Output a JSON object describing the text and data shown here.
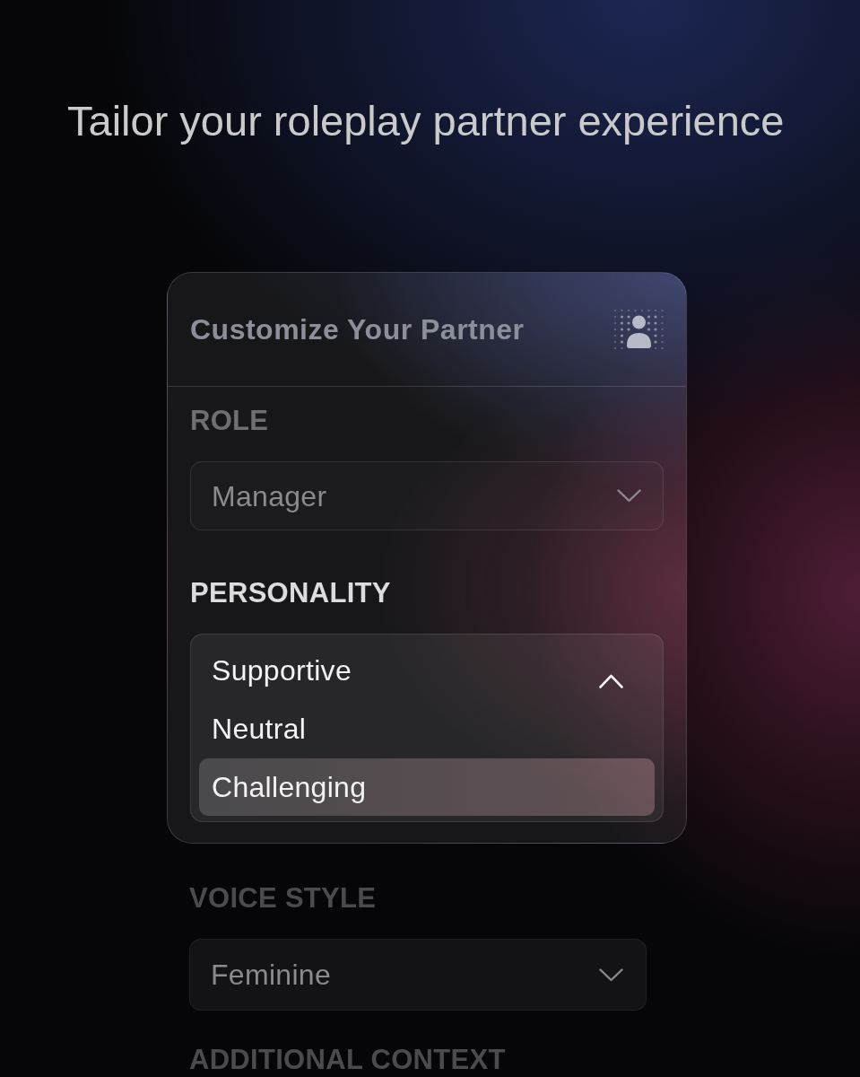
{
  "headline": "Tailor your roleplay partner experience",
  "card": {
    "title": "Customize Your Partner",
    "sections": [
      {
        "kind": "select",
        "label": "ROLE",
        "value": "Manager",
        "expanded": false
      },
      {
        "kind": "select",
        "label": "PERSONALITY",
        "expanded": true,
        "options": [
          {
            "label": "Supportive",
            "selected": false
          },
          {
            "label": "Neutral",
            "selected": false
          },
          {
            "label": "Challenging",
            "selected": true
          }
        ]
      }
    ]
  },
  "form": {
    "sections": [
      {
        "kind": "select",
        "label": "VOICE STYLE",
        "value": "Feminine",
        "expanded": false
      },
      {
        "kind": "heading",
        "label": "ADDITIONAL CONTEXT"
      }
    ]
  }
}
